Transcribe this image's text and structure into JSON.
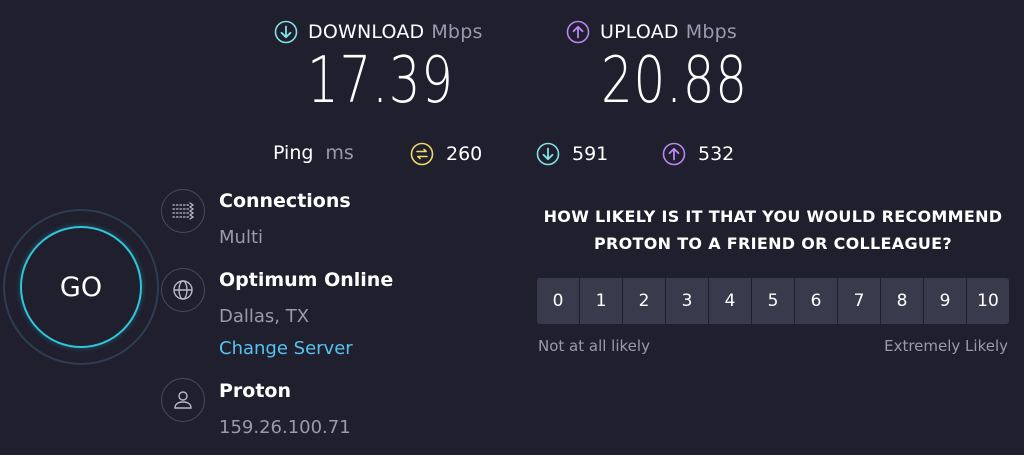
{
  "colors": {
    "background": "#1f1f2e",
    "download_accent": "#7ee2e6",
    "upload_accent": "#b984f4",
    "ping_accent": "#f0d76a",
    "go_ring": "#2fc6d9",
    "link": "#56c3f0"
  },
  "download": {
    "label": "DOWNLOAD",
    "unit": "Mbps",
    "value": "17.39",
    "icon": "download-arrow-icon"
  },
  "upload": {
    "label": "UPLOAD",
    "unit": "Mbps",
    "value": "20.88",
    "icon": "upload-arrow-icon"
  },
  "ping": {
    "label": "Ping",
    "unit": "ms",
    "idle": {
      "value": "260",
      "icon": "ping-idle-icon"
    },
    "download": {
      "value": "591",
      "icon": "download-arrow-icon"
    },
    "upload": {
      "value": "532",
      "icon": "upload-arrow-icon"
    }
  },
  "go_button": {
    "label": "GO"
  },
  "connections": {
    "title": "Connections",
    "value": "Multi",
    "icon": "connections-icon"
  },
  "isp": {
    "title": "Optimum Online",
    "location": "Dallas, TX",
    "change_server": "Change Server",
    "icon": "globe-icon"
  },
  "host": {
    "title": "Proton",
    "ip": "159.26.100.71",
    "icon": "user-icon"
  },
  "survey": {
    "question_line1": "HOW LIKELY IS IT THAT YOU WOULD RECOMMEND",
    "question_line2": "PROTON TO A FRIEND OR COLLEAGUE?",
    "scale": [
      "0",
      "1",
      "2",
      "3",
      "4",
      "5",
      "6",
      "7",
      "8",
      "9",
      "10"
    ],
    "low_label": "Not at all likely",
    "high_label": "Extremely Likely"
  }
}
